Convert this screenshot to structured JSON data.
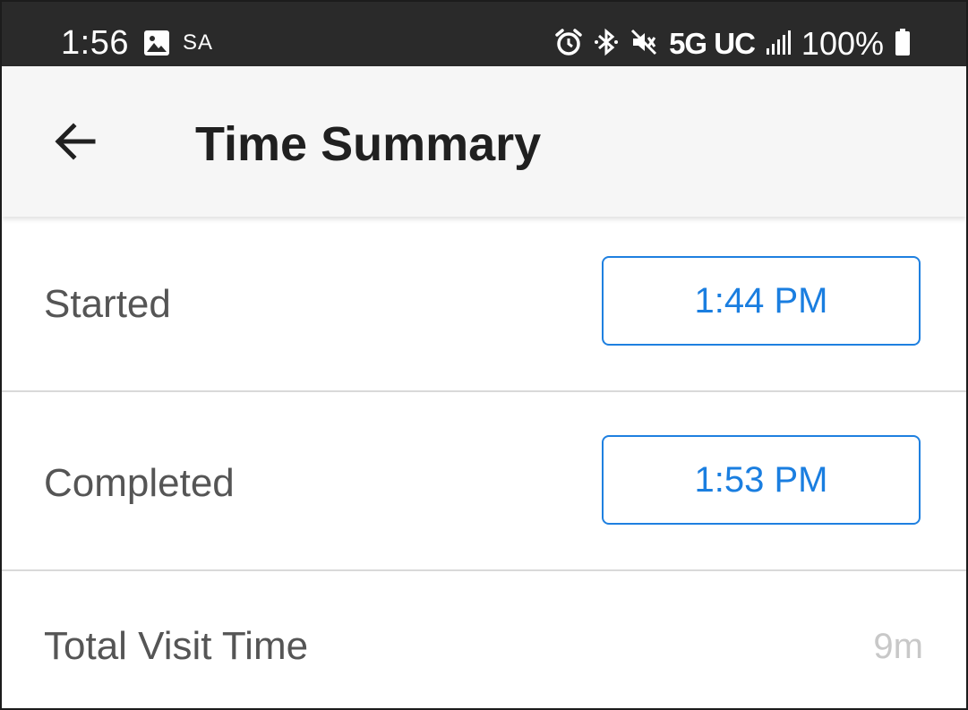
{
  "status_bar": {
    "time": "1:56",
    "carrier_label": "SA",
    "network": "5G UC",
    "battery": "100%",
    "icons": [
      "gallery-icon",
      "alarm-icon",
      "bluetooth-icon",
      "vibrate-mute-icon",
      "signal-icon",
      "battery-icon"
    ]
  },
  "header": {
    "title": "Time Summary",
    "back_icon": "arrow-back-icon"
  },
  "rows": {
    "started": {
      "label": "Started",
      "value": "1:44 PM"
    },
    "completed": {
      "label": "Completed",
      "value": "1:53 PM"
    },
    "total": {
      "label": "Total Visit Time",
      "value": "9m"
    }
  },
  "colors": {
    "accent": "#1f80e0",
    "status_bar_bg": "#2a2a2a",
    "app_bar_bg": "#f6f6f6",
    "muted_value": "#c8c8c8"
  }
}
